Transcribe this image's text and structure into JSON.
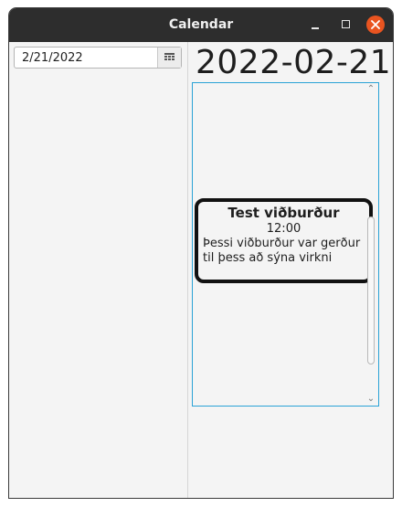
{
  "window": {
    "title": "Calendar"
  },
  "date_picker": {
    "value": "2/21/2022",
    "icon": "calendar-icon"
  },
  "main": {
    "date_heading": "2022-02-21"
  },
  "event": {
    "title": "Test viðburður",
    "time": "12:00",
    "description": "Þessi viðburður var gerður til þess að sýna virkni"
  },
  "colors": {
    "titlebar": "#2d2d2d",
    "close_button": "#e95420",
    "day_view_border": "#2aa2d6",
    "event_border": "#111111"
  }
}
